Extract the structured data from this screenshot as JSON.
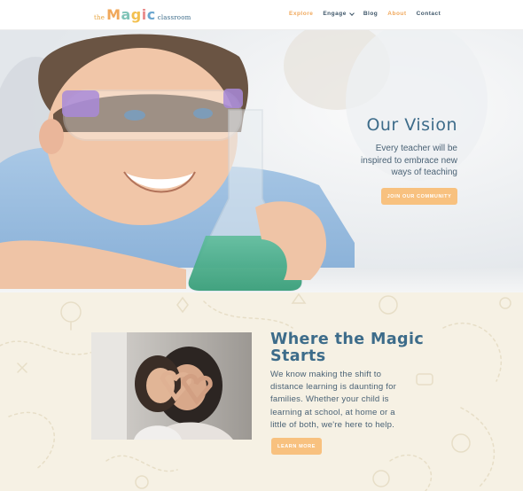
{
  "brand": {
    "logo_the": "the",
    "logo_magic_letters": [
      "M",
      "a",
      "g",
      "i",
      "c"
    ],
    "logo_magic_colors": [
      "#f0a75a",
      "#7fc4b8",
      "#f3c04f",
      "#e98a8a",
      "#6aa6cf"
    ],
    "logo_classroom": "classroom"
  },
  "nav": {
    "items": [
      {
        "label": "Explore",
        "active": true,
        "has_dropdown": false
      },
      {
        "label": "Engage",
        "active": false,
        "has_dropdown": true
      },
      {
        "label": "Blog",
        "active": false,
        "has_dropdown": false
      },
      {
        "label": "About",
        "active": true,
        "has_dropdown": false
      },
      {
        "label": "Contact",
        "active": false,
        "has_dropdown": false
      }
    ]
  },
  "hero": {
    "title": "Our Vision",
    "subtitle_lines": [
      "Every teacher will be",
      "inspired to embrace new",
      "ways of teaching"
    ],
    "cta_label": "JOIN OUR COMMUNITY"
  },
  "magic": {
    "title_line1": "Where the Magic",
    "title_line2": "Starts",
    "body_lines": [
      "We know making the shift to",
      "distance learning is daunting for",
      "families. Whether your child is",
      "learning at school, at home or a",
      "little of both, we're here to help."
    ],
    "cta_label": "LEARN MORE"
  },
  "colors": {
    "accent": "#f8c17f",
    "heading": "#3d6c8a",
    "nav_active": "#f0a75a",
    "section_bg": "#f6f1e4"
  }
}
